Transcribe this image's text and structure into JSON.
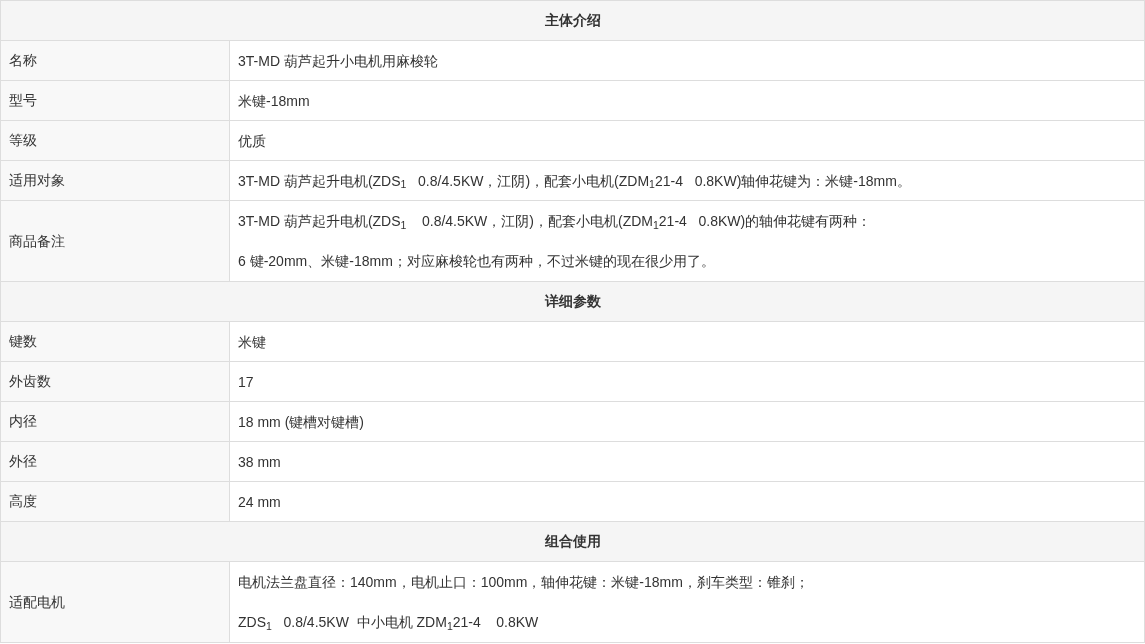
{
  "sections": [
    {
      "title": "主体介绍",
      "rows": [
        {
          "label": "名称",
          "lines": [
            "3T-MD 葫芦起升小电机用麻梭轮"
          ]
        },
        {
          "label": "型号",
          "lines": [
            "米键-18mm"
          ]
        },
        {
          "label": "等级",
          "lines": [
            "优质"
          ]
        },
        {
          "label": "适用对象",
          "lines": [
            "3T-MD 葫芦起升电机(ZDS$_{1}$   0.8/4.5KW，江阴)，配套小电机(ZDM$_{1}$21-4   0.8KW)轴伸花键为：米键-18mm。"
          ]
        },
        {
          "label": "商品备注",
          "lines": [
            "3T-MD 葫芦起升电机(ZDS$_{1}$    0.8/4.5KW，江阴)，配套小电机(ZDM$_{1}$21-4   0.8KW)的轴伸花键有两种：",
            "6 键-20mm、米键-18mm；对应麻梭轮也有两种，不过米键的现在很少用了。"
          ]
        }
      ]
    },
    {
      "title": "详细参数",
      "rows": [
        {
          "label": "键数",
          "lines": [
            "米键"
          ]
        },
        {
          "label": "外齿数",
          "lines": [
            "17"
          ]
        },
        {
          "label": "内径",
          "lines": [
            "18 mm (键槽对键槽)"
          ]
        },
        {
          "label": "外径",
          "lines": [
            "38 mm"
          ]
        },
        {
          "label": "高度",
          "lines": [
            "24 mm"
          ]
        }
      ]
    },
    {
      "title": "组合使用",
      "rows": [
        {
          "label": "适配电机",
          "lines": [
            "电机法兰盘直径：140mm，电机止口：100mm，轴伸花键：米键-18mm，刹车类型：锥刹；",
            "ZDS$_{1}$   0.8/4.5KW  中小电机 ZDM$_{1}$21-4    0.8KW"
          ]
        }
      ]
    }
  ]
}
